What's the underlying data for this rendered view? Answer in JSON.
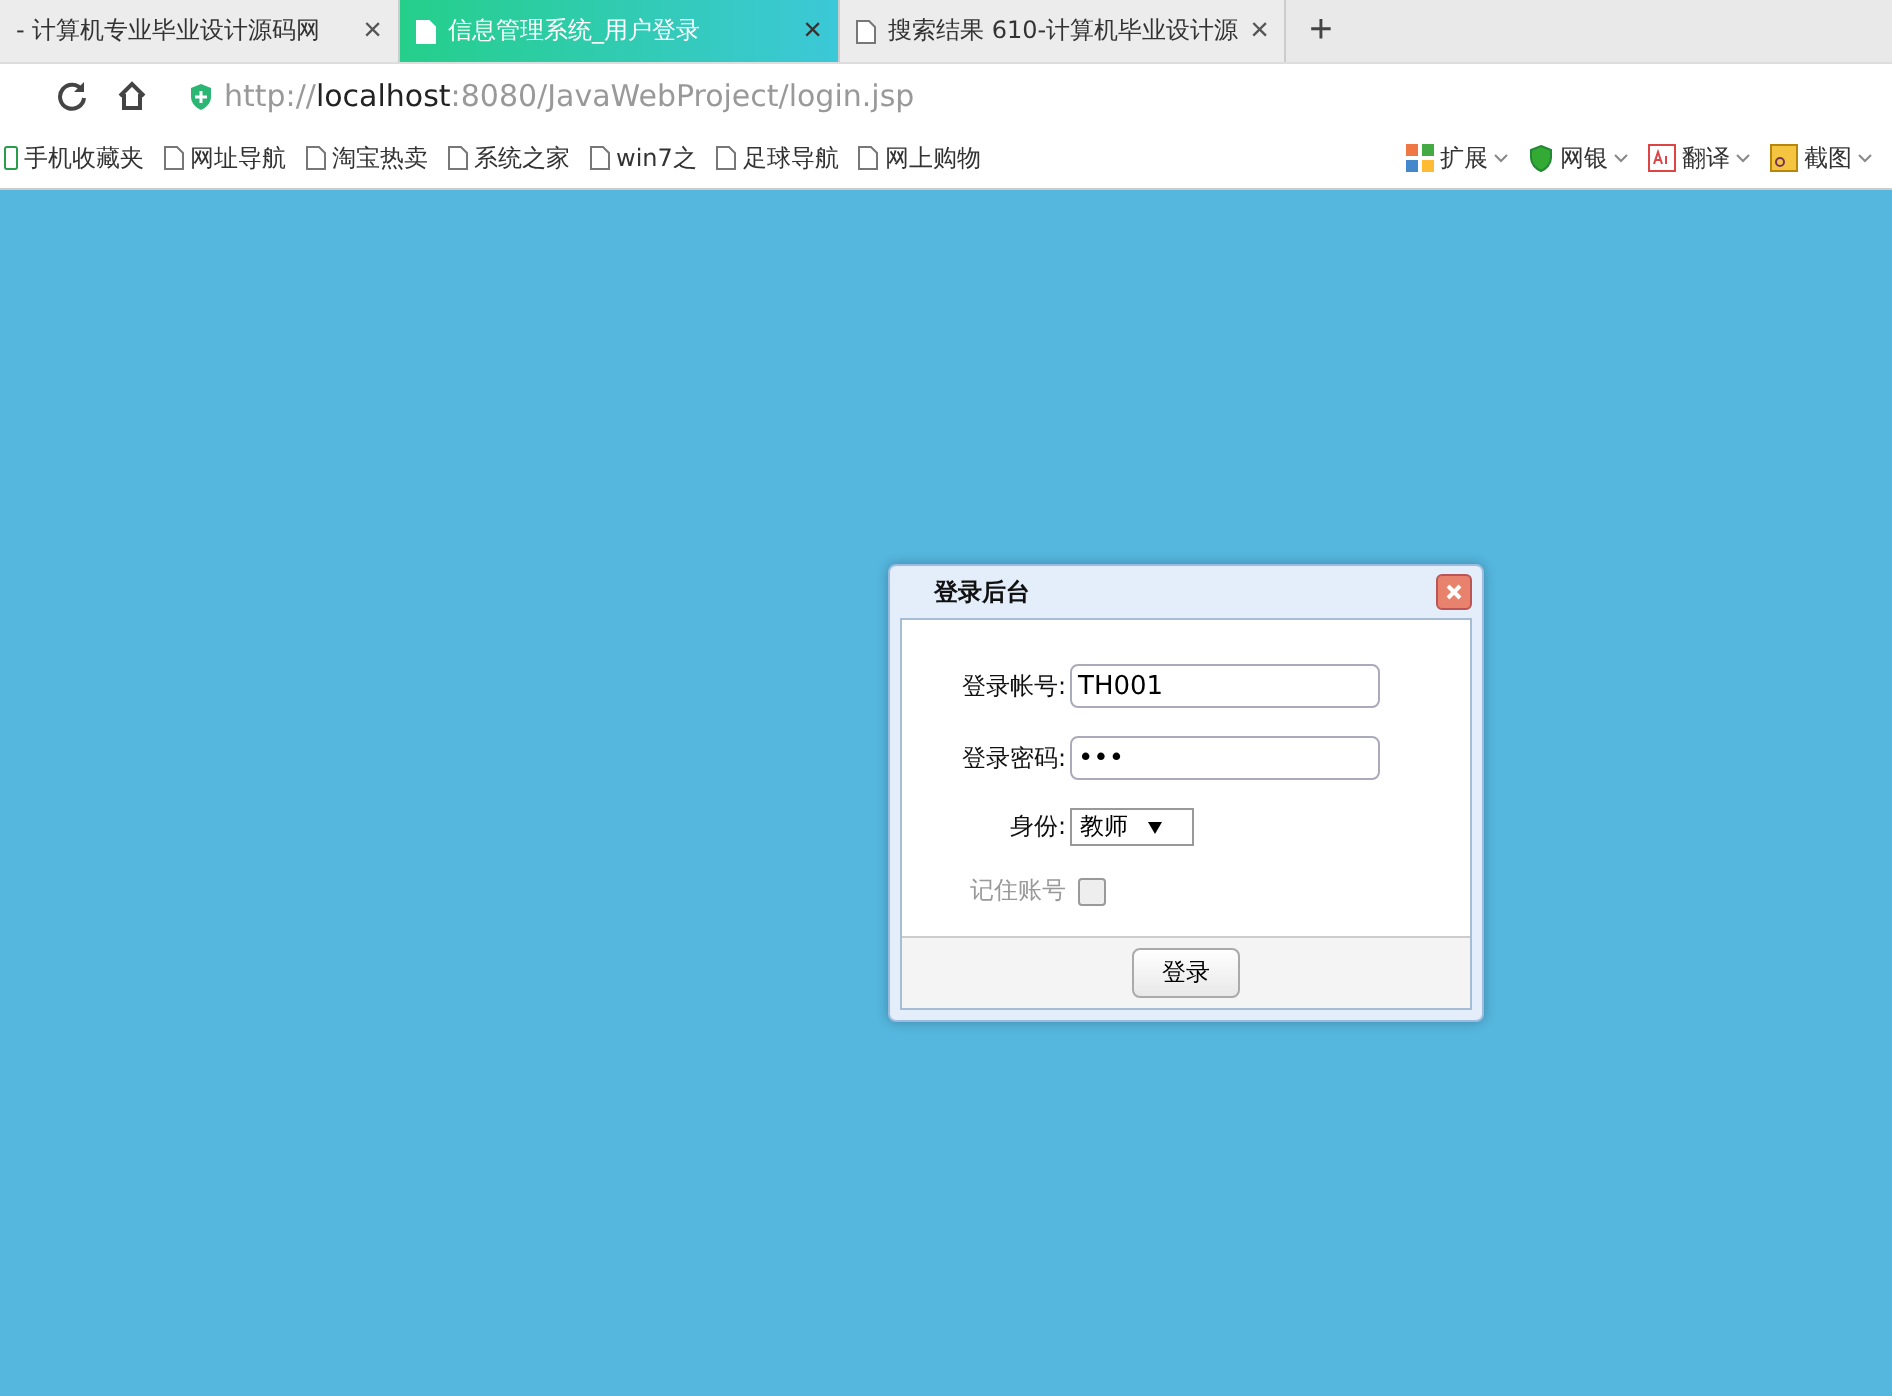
{
  "tabs": [
    {
      "label": "- 计算机专业毕业设计源码网",
      "selected": false,
      "close": "×"
    },
    {
      "label": "信息管理系统_用户登录",
      "selected": true,
      "close": "×"
    },
    {
      "label": "搜索结果 610-计算机毕业设计源",
      "selected": false,
      "close": "×"
    }
  ],
  "new_tab": "+",
  "address": "http://**localhost**:8080/JavaWebProject/login.jsp",
  "bookmarks": [
    {
      "label": "手机收藏夹",
      "kind": "phone"
    },
    {
      "label": "网址导航",
      "kind": "page"
    },
    {
      "label": "淘宝热卖",
      "kind": "page"
    },
    {
      "label": "系统之家",
      "kind": "page"
    },
    {
      "label": "win7之",
      "kind": "page"
    },
    {
      "label": "足球导航",
      "kind": "page"
    },
    {
      "label": "网上购物",
      "kind": "page"
    }
  ],
  "toolbar": [
    {
      "label": "扩展",
      "kind": "grid"
    },
    {
      "label": "网银",
      "kind": "shield"
    },
    {
      "label": "翻译",
      "kind": "translate"
    },
    {
      "label": "截图",
      "kind": "scissors"
    }
  ],
  "dialog": {
    "title": "登录后台",
    "fields": [
      {
        "label": "登录帐号:",
        "kind": "text",
        "value": "TH001"
      },
      {
        "label": "登录密码:",
        "kind": "text",
        "value": "•••"
      },
      {
        "label": "身份:",
        "kind": "select",
        "value": "教师"
      },
      {
        "label": "记住账号",
        "kind": "checkbox",
        "checked": false
      }
    ],
    "button": "登录"
  }
}
